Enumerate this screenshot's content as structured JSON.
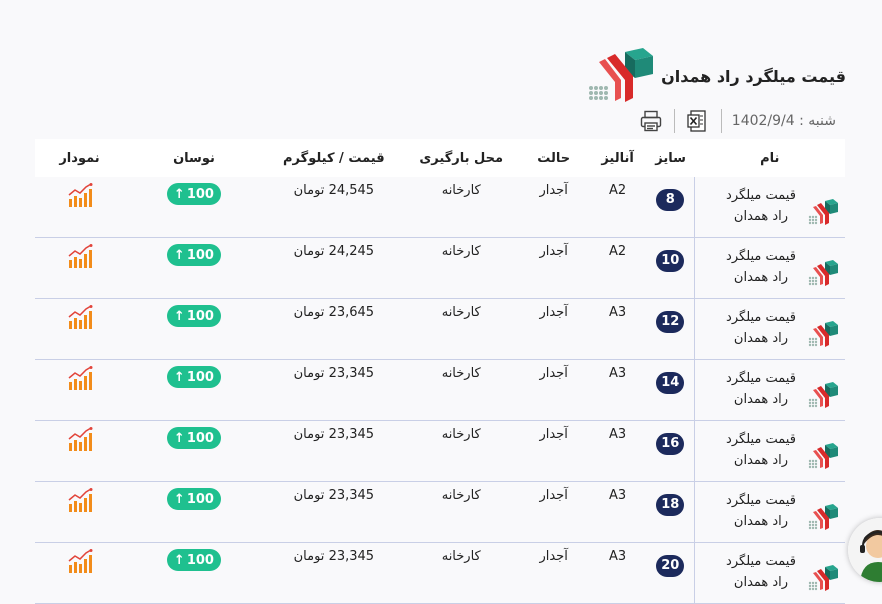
{
  "page": {
    "title": "قیمت میلگرد راد همدان",
    "date_label": "شنبه : 1402/9/4"
  },
  "table": {
    "headers": {
      "name": "نام",
      "size": "سایز",
      "analysis": "آنالیز",
      "state": "حالت",
      "location": "محل بارگیری",
      "price": "قیمت / کیلوگرم",
      "change": "نوسان",
      "chart": "نمودار"
    },
    "rows": [
      {
        "name": "قیمت میلگرد راد همدان",
        "size": "8",
        "analysis": "A2",
        "state": "آجدار",
        "location": "کارخانه",
        "price": "24,545 تومان",
        "change": "100"
      },
      {
        "name": "قیمت میلگرد راد همدان",
        "size": "10",
        "analysis": "A2",
        "state": "آجدار",
        "location": "کارخانه",
        "price": "24,245 تومان",
        "change": "100"
      },
      {
        "name": "قیمت میلگرد راد همدان",
        "size": "12",
        "analysis": "A3",
        "state": "آجدار",
        "location": "کارخانه",
        "price": "23,645 تومان",
        "change": "100"
      },
      {
        "name": "قیمت میلگرد راد همدان",
        "size": "14",
        "analysis": "A3",
        "state": "آجدار",
        "location": "کارخانه",
        "price": "23,345 تومان",
        "change": "100"
      },
      {
        "name": "قیمت میلگرد راد همدان",
        "size": "16",
        "analysis": "A3",
        "state": "آجدار",
        "location": "کارخانه",
        "price": "23,345 تومان",
        "change": "100"
      },
      {
        "name": "قیمت میلگرد راد همدان",
        "size": "18",
        "analysis": "A3",
        "state": "آجدار",
        "location": "کارخانه",
        "price": "23,345 تومان",
        "change": "100"
      },
      {
        "name": "قیمت میلگرد راد همدان",
        "size": "20",
        "analysis": "A3",
        "state": "آجدار",
        "location": "کارخانه",
        "price": "23,345 تومان",
        "change": "100"
      }
    ]
  },
  "colors": {
    "size_badge": "#1c2a5c",
    "change_badge": "#1fc08f",
    "chart_icon": "#f28c1a",
    "logo_red": "#d82a2a",
    "logo_teal": "#1f8a78"
  },
  "icons": {
    "print": "printer-icon",
    "excel": "excel-icon",
    "chart": "chart-icon",
    "change": "arrow-up-icon",
    "support": "support-avatar-icon"
  }
}
